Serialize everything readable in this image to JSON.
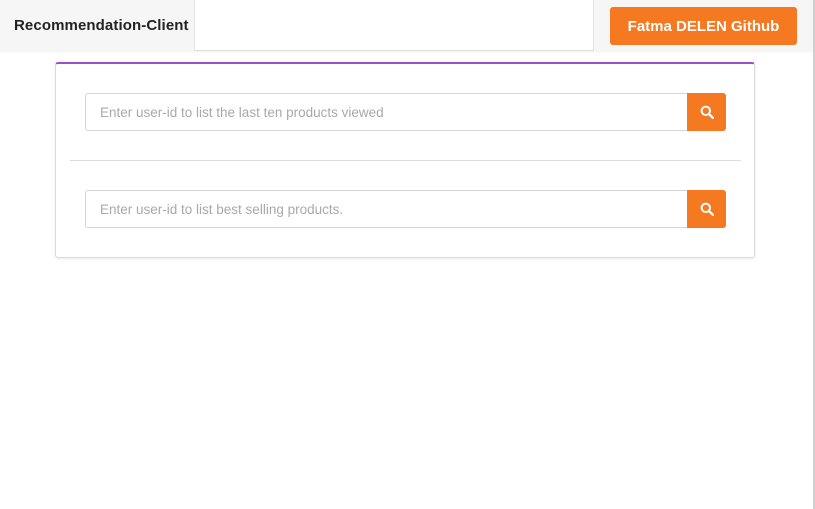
{
  "navbar": {
    "brand": "Recommendation-Client",
    "github_button": "Fatma DELEN Github"
  },
  "card": {
    "search_last_viewed": {
      "placeholder": "Enter user-id to list the last ten products viewed",
      "value": "",
      "button_icon": "search-icon"
    },
    "search_best_selling": {
      "placeholder": "Enter user-id to list best selling products.",
      "value": "",
      "button_icon": "search-icon"
    }
  },
  "colors": {
    "accent": "#f47920",
    "card_top_border": "#9c4fc6"
  }
}
